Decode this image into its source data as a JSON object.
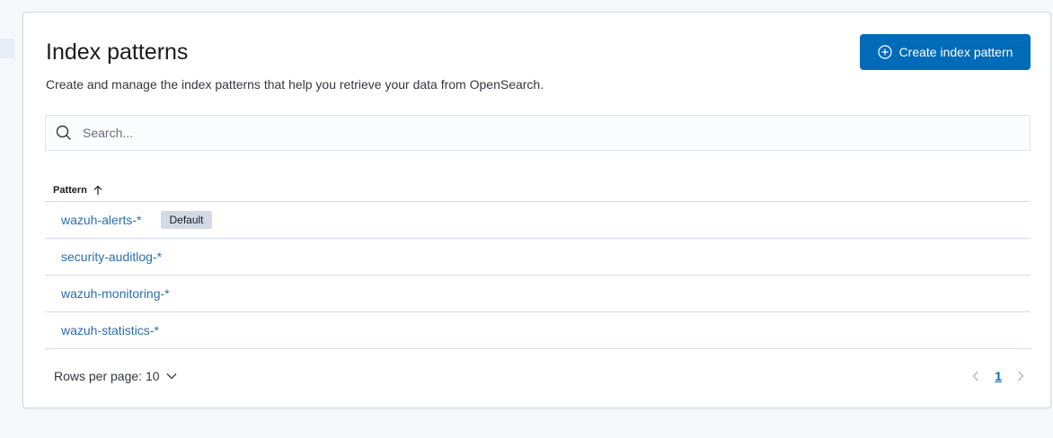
{
  "header": {
    "title": "Index patterns",
    "subtitle": "Create and manage the index patterns that help you retrieve your data from OpenSearch.",
    "create_button_label": "Create index pattern",
    "create_button_icon": "plus-in-circle-icon"
  },
  "search": {
    "placeholder": "Search...",
    "value": "",
    "icon": "search-icon"
  },
  "table": {
    "columns": [
      {
        "label": "Pattern",
        "sort": "ascending"
      }
    ],
    "rows": [
      {
        "pattern": "wazuh-alerts-*",
        "badge": "Default"
      },
      {
        "pattern": "security-auditlog-*",
        "badge": ""
      },
      {
        "pattern": "wazuh-monitoring-*",
        "badge": ""
      },
      {
        "pattern": "wazuh-statistics-*",
        "badge": ""
      }
    ]
  },
  "footer": {
    "rows_per_page_label": "Rows per page: 10",
    "current_page": "1"
  },
  "colors": {
    "primary": "#006bb8",
    "link": "#2a6eaf",
    "badge_bg": "#d3dae6",
    "border": "#d3dae6",
    "page_bg": "#f7f8fc"
  }
}
